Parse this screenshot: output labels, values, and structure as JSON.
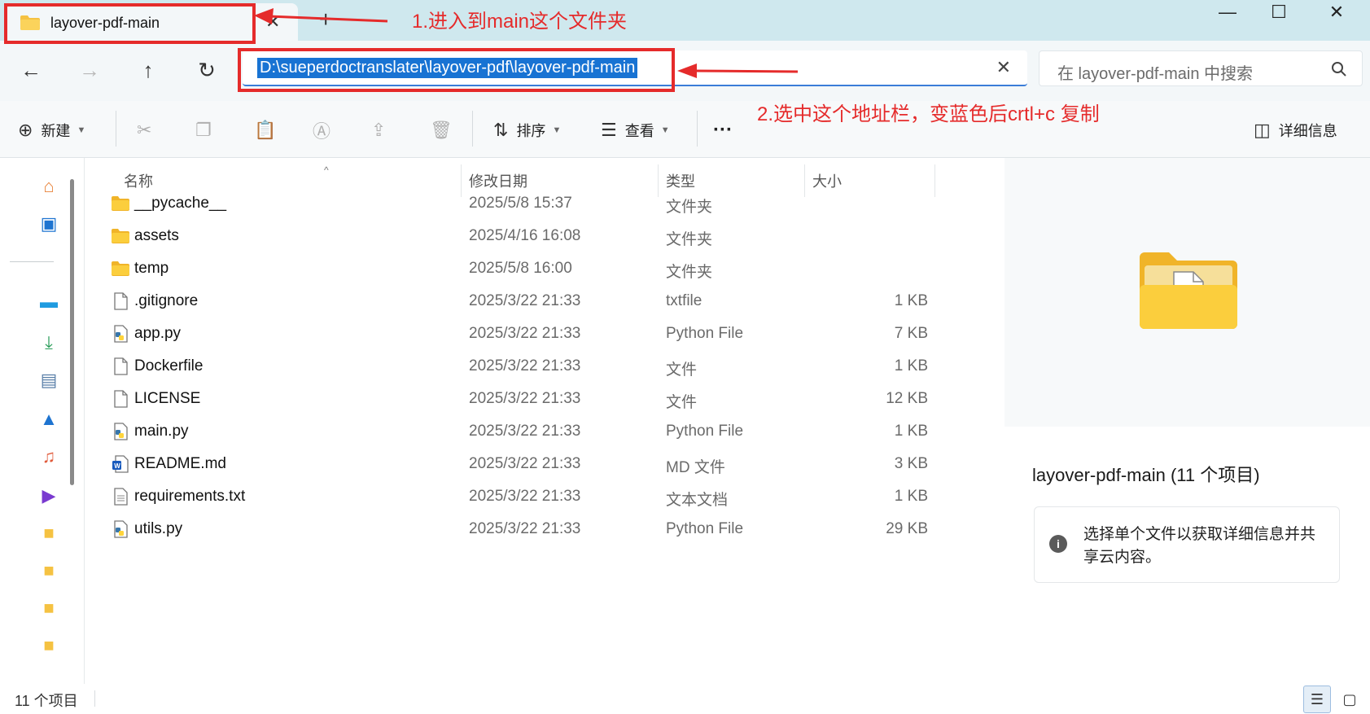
{
  "window": {
    "tab_title": "layover-pdf-main",
    "new_tab_label": "+",
    "minimize": "—",
    "maximize": "☐",
    "close": "✕"
  },
  "navigation": {
    "address": "D:\\sueperdoctranslater\\layover-pdf\\layover-pdf-main",
    "search_placeholder": "在 layover-pdf-main 中搜索"
  },
  "toolbar": {
    "new_label": "新建",
    "sort_label": "排序",
    "view_label": "查看",
    "more_label": "···",
    "details_label": "详细信息"
  },
  "columns": {
    "name": "名称",
    "date": "修改日期",
    "type": "类型",
    "size": "大小"
  },
  "files": [
    {
      "name": "__pycache__",
      "date": "2025/5/8 15:37",
      "type": "文件夹",
      "size": "",
      "icon": "folder-icon"
    },
    {
      "name": "assets",
      "date": "2025/4/16 16:08",
      "type": "文件夹",
      "size": "",
      "icon": "folder-icon"
    },
    {
      "name": "temp",
      "date": "2025/5/8 16:00",
      "type": "文件夹",
      "size": "",
      "icon": "folder-icon"
    },
    {
      "name": ".gitignore",
      "date": "2025/3/22 21:33",
      "type": "txtfile",
      "size": "1 KB",
      "icon": "file-icon"
    },
    {
      "name": "app.py",
      "date": "2025/3/22 21:33",
      "type": "Python File",
      "size": "7 KB",
      "icon": "python-file-icon"
    },
    {
      "name": "Dockerfile",
      "date": "2025/3/22 21:33",
      "type": "文件",
      "size": "1 KB",
      "icon": "file-icon"
    },
    {
      "name": "LICENSE",
      "date": "2025/3/22 21:33",
      "type": "文件",
      "size": "12 KB",
      "icon": "file-icon"
    },
    {
      "name": "main.py",
      "date": "2025/3/22 21:33",
      "type": "Python File",
      "size": "1 KB",
      "icon": "python-file-icon"
    },
    {
      "name": "README.md",
      "date": "2025/3/22 21:33",
      "type": "MD 文件",
      "size": "3 KB",
      "icon": "word-file-icon"
    },
    {
      "name": "requirements.txt",
      "date": "2025/3/22 21:33",
      "type": "文本文档",
      "size": "1 KB",
      "icon": "text-file-icon"
    },
    {
      "name": "utils.py",
      "date": "2025/3/22 21:33",
      "type": "Python File",
      "size": "29 KB",
      "icon": "python-file-icon"
    }
  ],
  "details_pane": {
    "title": "layover-pdf-main (11 个项目)",
    "info": "选择单个文件以获取详细信息并共享云内容。"
  },
  "status": {
    "item_count": "11 个项目"
  },
  "annotations": {
    "step1": "1.进入到main这个文件夹",
    "step2": "2.选中这个地址栏，变蓝色后crtl+c 复制"
  },
  "colors": {
    "annotation": "#e52b2b",
    "selection": "#1873d3",
    "folder": "#f5c242"
  }
}
